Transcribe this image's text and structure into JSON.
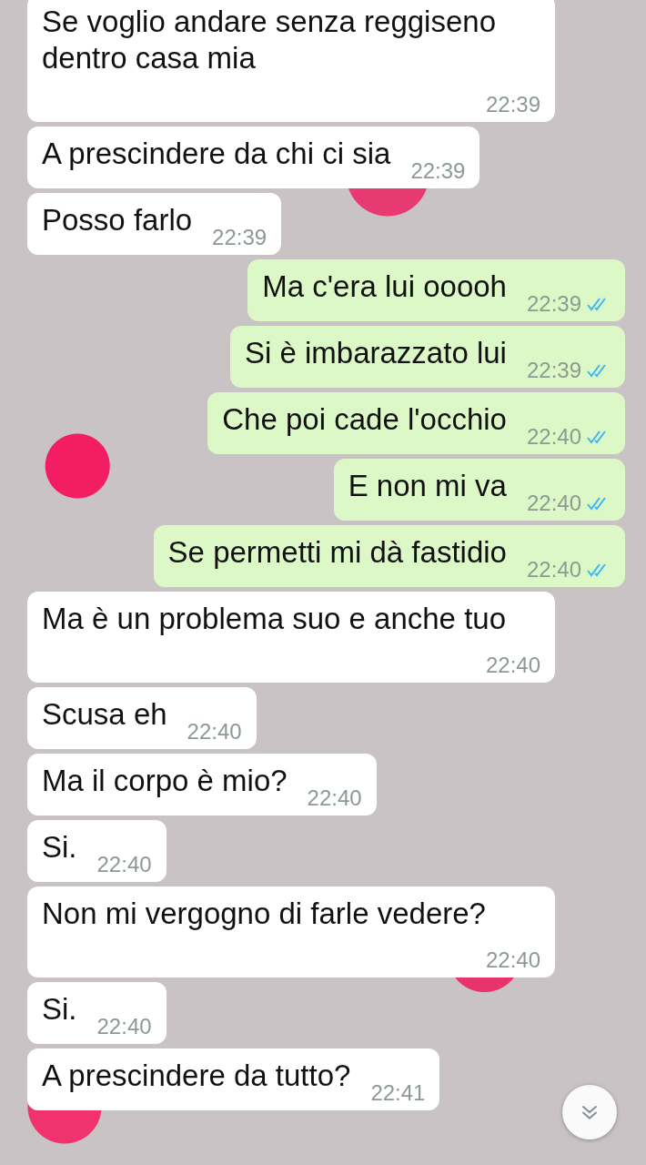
{
  "messages": [
    {
      "kind": "incoming",
      "text": "Se voglio andare senza reggiseno dentro casa mia",
      "time": "22:39"
    },
    {
      "kind": "incoming",
      "text": "A prescindere da chi ci sia",
      "time": "22:39"
    },
    {
      "kind": "incoming",
      "text": "Posso farlo",
      "time": "22:39"
    },
    {
      "kind": "outgoing",
      "text": "Ma c'era lui ooooh",
      "time": "22:39",
      "read": true
    },
    {
      "kind": "outgoing",
      "text": "Si è imbarazzato lui",
      "time": "22:39",
      "read": true
    },
    {
      "kind": "outgoing",
      "text": "Che poi cade l'occhio",
      "time": "22:40",
      "read": true
    },
    {
      "kind": "outgoing",
      "text": "E non mi va",
      "time": "22:40",
      "read": true
    },
    {
      "kind": "outgoing",
      "text": "Se permetti mi dà fastidio",
      "time": "22:40",
      "read": true
    },
    {
      "kind": "incoming",
      "text": "Ma è un problema suo e anche tuo",
      "time": "22:40"
    },
    {
      "kind": "incoming",
      "text": "Scusa eh",
      "time": "22:40"
    },
    {
      "kind": "incoming",
      "text": "Ma il corpo è mio?",
      "time": "22:40"
    },
    {
      "kind": "incoming",
      "text": "Si.",
      "time": "22:40"
    },
    {
      "kind": "incoming",
      "text": "Non mi vergogno di farle vedere?",
      "time": "22:40"
    },
    {
      "kind": "incoming",
      "text": "Si.",
      "time": "22:40"
    },
    {
      "kind": "incoming",
      "text": "A prescindere da tutto?",
      "time": "22:41"
    }
  ]
}
